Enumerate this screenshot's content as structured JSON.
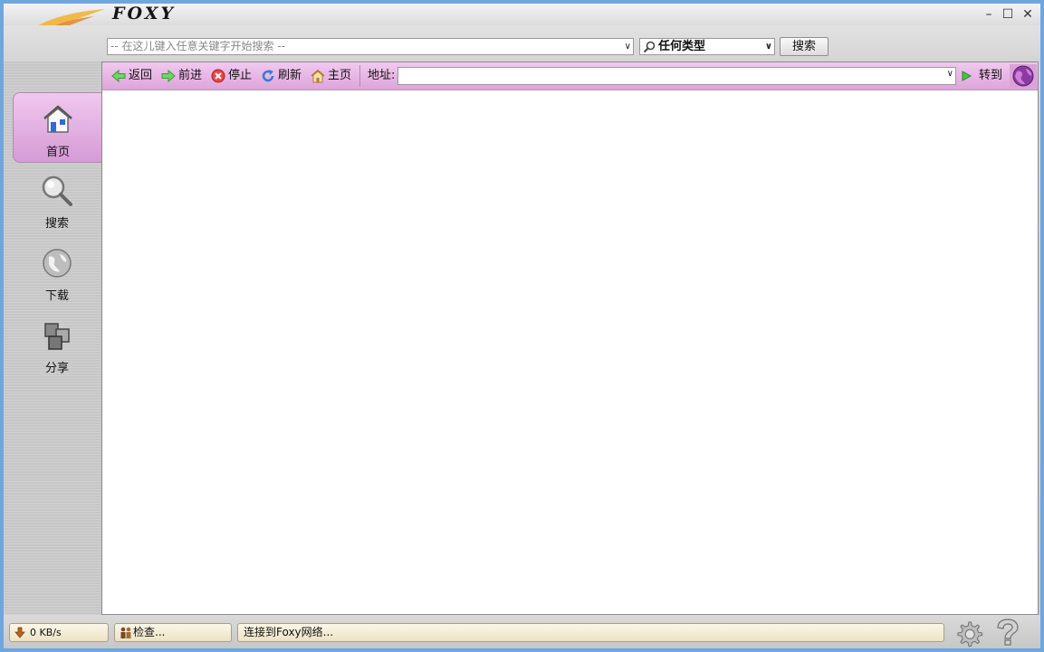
{
  "app": {
    "brand": "FOXY"
  },
  "window_controls": {
    "minimize": "–",
    "maximize": "☐",
    "close": "✕"
  },
  "search": {
    "keyword_placeholder": "-- 在这儿键入任意关键字开始搜索 --",
    "type_value": "任何类型",
    "search_button": "搜索"
  },
  "sidebar": {
    "items": [
      {
        "label": "首页",
        "icon": "home-icon",
        "active": true
      },
      {
        "label": "搜索",
        "icon": "magnifier-icon",
        "active": false
      },
      {
        "label": "下载",
        "icon": "globe-icon",
        "active": false
      },
      {
        "label": "分享",
        "icon": "cubes-icon",
        "active": false
      }
    ]
  },
  "navbar": {
    "back": "返回",
    "forward": "前进",
    "stop": "停止",
    "refresh": "刷新",
    "home": "主页",
    "address_label": "地址:",
    "address_value": "",
    "go": "转到"
  },
  "status": {
    "speed": "0 KB/s",
    "check": "检查...",
    "message": "连接到Foxy网络..."
  },
  "colors": {
    "accent_pink": "#dca6da",
    "window_frame": "#6fa6de",
    "status_field": "#f3ecd4"
  }
}
